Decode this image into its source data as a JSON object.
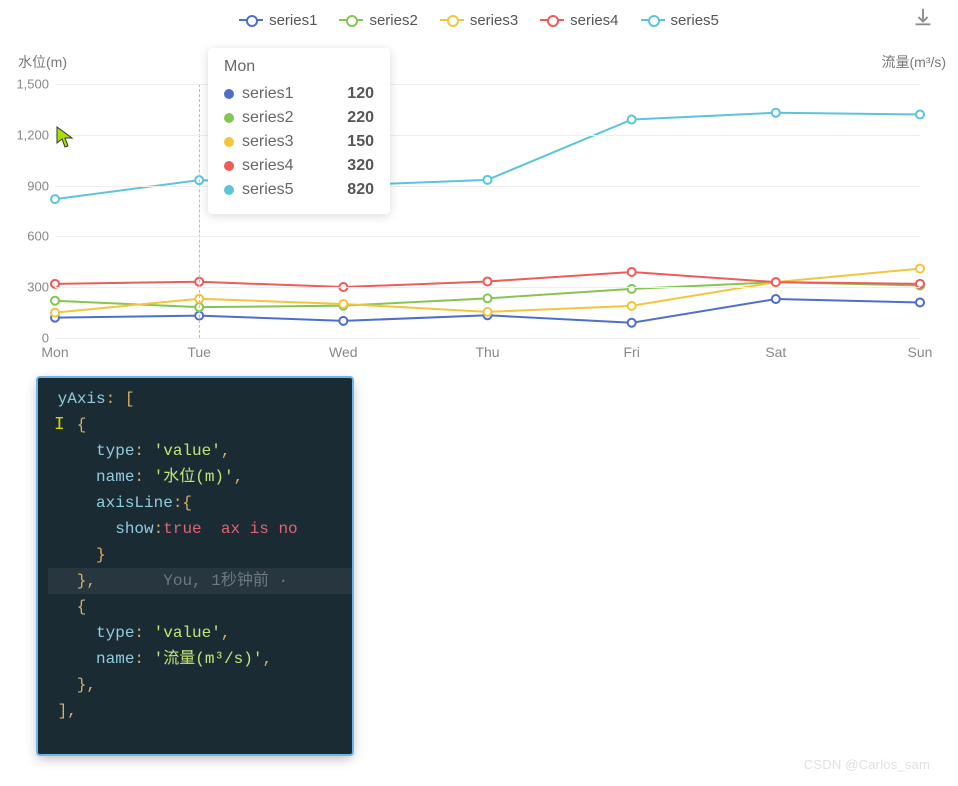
{
  "chart_data": {
    "type": "line",
    "categories": [
      "Mon",
      "Tue",
      "Wed",
      "Thu",
      "Fri",
      "Sat",
      "Sun"
    ],
    "series": [
      {
        "name": "series1",
        "color": "#4e6ecb",
        "values": [
          120,
          132,
          101,
          134,
          90,
          230,
          210
        ]
      },
      {
        "name": "series2",
        "color": "#86c552",
        "values": [
          220,
          182,
          191,
          234,
          290,
          330,
          310
        ]
      },
      {
        "name": "series3",
        "color": "#f2c53d",
        "values": [
          150,
          232,
          201,
          154,
          190,
          330,
          410
        ]
      },
      {
        "name": "series4",
        "color": "#ef5a5a",
        "values": [
          320,
          332,
          301,
          334,
          390,
          330,
          320
        ]
      },
      {
        "name": "series5",
        "color": "#5cc4db",
        "values": [
          820,
          932,
          901,
          934,
          1290,
          1330,
          1320
        ]
      }
    ],
    "ylabel_left": "水位(m)",
    "ylabel_right": "流量(m³/s)",
    "yticks": [
      0,
      300,
      600,
      900,
      1200,
      1500
    ],
    "ylim": [
      0,
      1500
    ]
  },
  "tooltip": {
    "title": "Mon",
    "rows": [
      {
        "color": "#4e6ecb",
        "name": "series1",
        "value": "120"
      },
      {
        "color": "#86c552",
        "name": "series2",
        "value": "220"
      },
      {
        "color": "#f2c53d",
        "name": "series3",
        "value": "150"
      },
      {
        "color": "#ef5a5a",
        "name": "series4",
        "value": "320"
      },
      {
        "color": "#5cc4db",
        "name": "series5",
        "value": "820"
      }
    ]
  },
  "code": {
    "lines": [
      {
        "segs": [
          [
            " ",
            "plain"
          ],
          [
            "yAxis",
            "key"
          ],
          [
            ": [",
            "punc"
          ]
        ]
      },
      {
        "segs": [
          [
            "   {",
            "punc"
          ]
        ]
      },
      {
        "segs": [
          [
            "     ",
            "plain"
          ],
          [
            "type",
            "key"
          ],
          [
            ": ",
            "punc"
          ],
          [
            "'value'",
            "str"
          ],
          [
            ",",
            "punc"
          ]
        ]
      },
      {
        "segs": [
          [
            "     ",
            "plain"
          ],
          [
            "name",
            "key"
          ],
          [
            ": ",
            "punc"
          ],
          [
            "'水位(m)'",
            "str"
          ],
          [
            ",",
            "punc"
          ]
        ]
      },
      {
        "segs": [
          [
            "     ",
            "plain"
          ],
          [
            "axisLine",
            "key"
          ],
          [
            ":{",
            "punc"
          ]
        ]
      },
      {
        "segs": [
          [
            "       ",
            "plain"
          ],
          [
            "show",
            "key"
          ],
          [
            ":",
            "punc"
          ],
          [
            "true",
            "bool"
          ],
          [
            "  ",
            "plain"
          ],
          [
            "ax is no",
            "err"
          ]
        ]
      },
      {
        "segs": [
          [
            "     }",
            "punc"
          ]
        ]
      },
      {
        "hl": true,
        "segs": [
          [
            "   },",
            "punc"
          ],
          [
            "       ",
            "plain"
          ],
          [
            "You, 1秒钟前 · ",
            "cmt"
          ]
        ]
      },
      {
        "segs": [
          [
            "   {",
            "punc"
          ]
        ]
      },
      {
        "segs": [
          [
            "     ",
            "plain"
          ],
          [
            "type",
            "key"
          ],
          [
            ": ",
            "punc"
          ],
          [
            "'value'",
            "str"
          ],
          [
            ",",
            "punc"
          ]
        ]
      },
      {
        "segs": [
          [
            "     ",
            "plain"
          ],
          [
            "name",
            "key"
          ],
          [
            ": ",
            "punc"
          ],
          [
            "'流量(m³/s)'",
            "str"
          ],
          [
            ",",
            "punc"
          ]
        ]
      },
      {
        "segs": [
          [
            "   },",
            "punc"
          ]
        ]
      },
      {
        "segs": [
          [
            " ],",
            "punc"
          ]
        ]
      }
    ]
  },
  "watermark": "CSDN @Carlos_sam"
}
